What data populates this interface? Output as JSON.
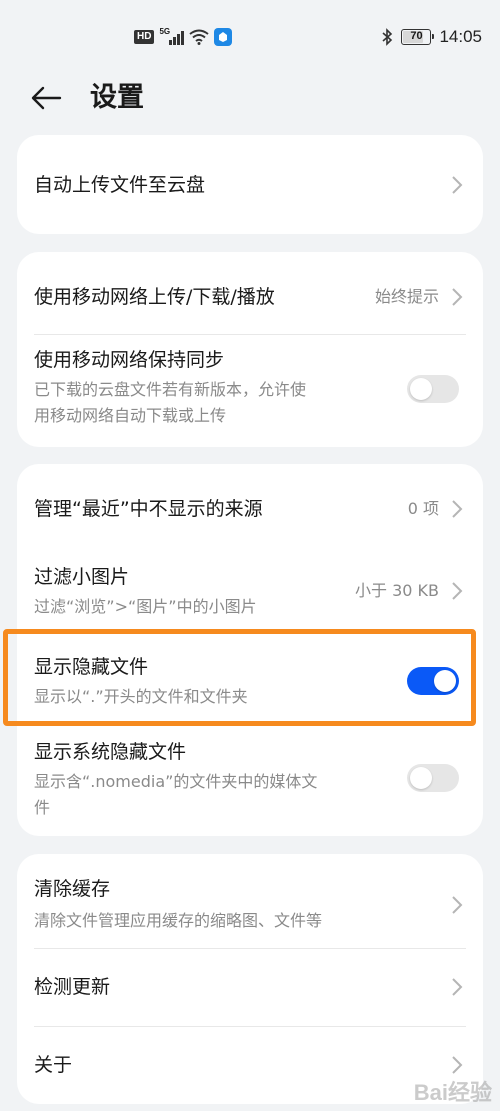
{
  "status_bar": {
    "hd_label": "HD",
    "network_label": "5G",
    "battery_level": "70",
    "time": "14:05",
    "icons": [
      "hd-icon",
      "signal-icon",
      "wifi-icon",
      "notification-icon",
      "bluetooth-icon",
      "battery-icon"
    ]
  },
  "header": {
    "title": "设置",
    "back_icon": "arrow-left-icon"
  },
  "cards": {
    "upload": {
      "auto_upload": {
        "title": "自动上传文件至云盘"
      }
    },
    "mobile": {
      "mobile_transfer": {
        "title": "使用移动网络上传/下载/播放",
        "value": "始终提示"
      },
      "mobile_sync": {
        "title": "使用移动网络保持同步",
        "subtitle_line1": "已下载的云盘文件若有新版本，允许使",
        "subtitle_line2": "用移动网络自动下载或上传",
        "enabled": false
      }
    },
    "display": {
      "recent_sources": {
        "title": "管理“最近”中不显示的来源",
        "value": "0 项"
      },
      "filter_small": {
        "title": "过滤小图片",
        "subtitle": "过滤“浏览”>“图片”中的小图片",
        "value": "小于 30 KB"
      },
      "show_hidden": {
        "title": "显示隐藏文件",
        "subtitle": "显示以“.”开头的文件和文件夹",
        "enabled": true
      },
      "show_system_hidden": {
        "title": "显示系统隐藏文件",
        "subtitle_line1": "显示含“.nomedia”的文件夹中的媒体文",
        "subtitle_line2": "件",
        "enabled": false
      }
    },
    "misc": {
      "clear_cache": {
        "title": "清除缓存",
        "subtitle": "清除文件管理应用缓存的缩略图、文件等"
      },
      "check_update": {
        "title": "检测更新"
      },
      "about": {
        "title": "关于"
      }
    }
  },
  "colors": {
    "toggle_on": "#0a59f7",
    "toggle_off": "#e6e6e6",
    "highlight": "#f68a1e",
    "background": "#f1f3f5"
  },
  "watermark": "Bai经验"
}
